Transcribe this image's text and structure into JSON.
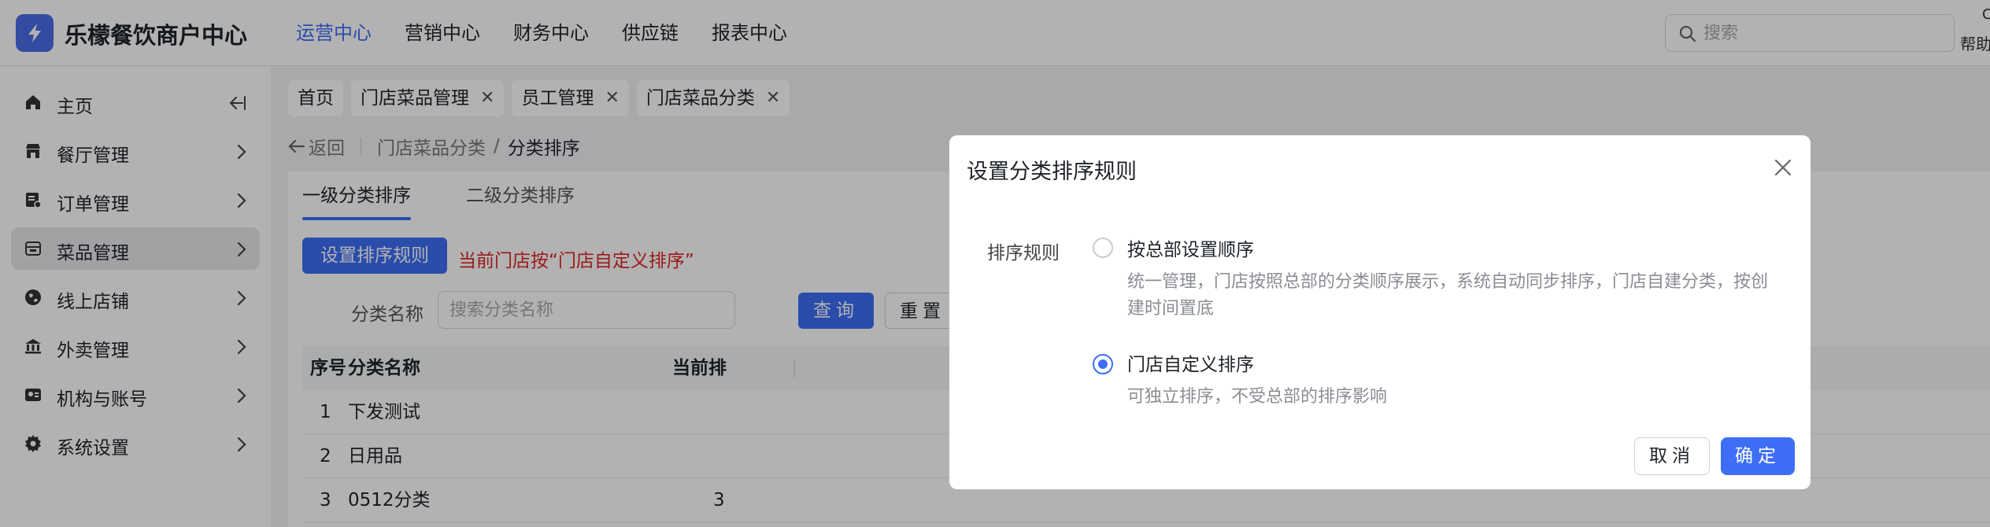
{
  "header": {
    "app_name": "乐檬餐饮商户中心",
    "nav": [
      {
        "label": "运营中心",
        "active": true
      },
      {
        "label": "营销中心"
      },
      {
        "label": "财务中心"
      },
      {
        "label": "供应链"
      },
      {
        "label": "报表中心"
      }
    ],
    "search_placeholder": "搜索",
    "help_label": "帮助",
    "help_top": "C"
  },
  "sidebar": {
    "items": [
      {
        "label": "主页",
        "icon": "home-icon"
      },
      {
        "label": "餐厅管理",
        "icon": "store-icon"
      },
      {
        "label": "订单管理",
        "icon": "order-icon"
      },
      {
        "label": "菜品管理",
        "icon": "dish-icon",
        "active": true
      },
      {
        "label": "线上店铺",
        "icon": "globe-icon"
      },
      {
        "label": "外卖管理",
        "icon": "bank-icon"
      },
      {
        "label": "机构与账号",
        "icon": "id-card-icon"
      },
      {
        "label": "系统设置",
        "icon": "gear-icon"
      }
    ]
  },
  "tabs": [
    {
      "label": "首页"
    },
    {
      "label": "门店菜品管理"
    },
    {
      "label": "员工管理"
    },
    {
      "label": "门店菜品分类",
      "active": true
    }
  ],
  "breadcrumb": {
    "back": "返回",
    "parent": "门店菜品分类",
    "current": "分类排序"
  },
  "main": {
    "sub_tabs": [
      {
        "label": "一级分类排序",
        "active": true
      },
      {
        "label": "二级分类排序"
      }
    ],
    "rule_button": "设置排序规则",
    "current_rule": "当前门店按“门店自定义排序”",
    "filter_label": "分类名称",
    "filter_placeholder": "搜索分类名称",
    "query_button": "查询",
    "reset_button": "重置",
    "table": {
      "columns": [
        "序号",
        "分类名称",
        "当前排"
      ],
      "rows": [
        {
          "index": "1",
          "name": "下发测试",
          "sort": ""
        },
        {
          "index": "2",
          "name": "日用品",
          "sort": ""
        },
        {
          "index": "3",
          "name": "0512分类",
          "sort": "3"
        }
      ]
    }
  },
  "modal": {
    "title": "设置分类排序规则",
    "field_label": "排序规则",
    "options": [
      {
        "label": "按总部设置顺序",
        "desc": "统一管理，门店按照总部的分类顺序展示，系统自动同步排序，门店自建分类，按创建时间置底",
        "checked": false
      },
      {
        "label": "门店自定义排序",
        "desc": "可独立排序，不受总部的排序影响",
        "checked": true
      }
    ],
    "cancel": "取消",
    "ok": "确定"
  },
  "colors": {
    "accent": "#3d6ef5",
    "warning_text": "#e02424",
    "mask": "rgba(0,0,0,0.3)"
  }
}
